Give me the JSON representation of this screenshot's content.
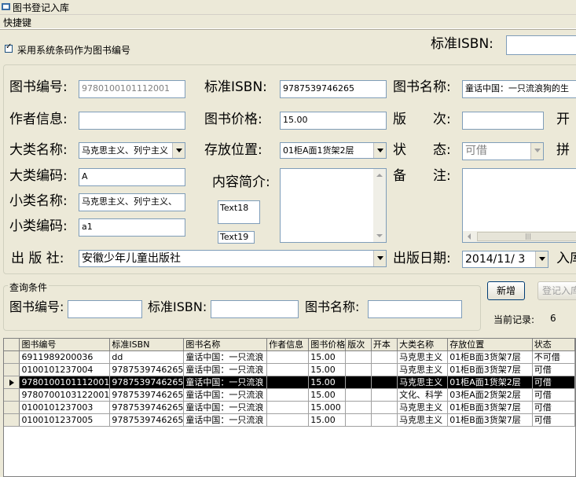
{
  "window": {
    "title": "图书登记入库"
  },
  "menu": {
    "shortcuts": "快捷键"
  },
  "top": {
    "use_barcode_label": "采用系统条码作为图书编号",
    "use_barcode_checked": true,
    "isbn_label": "标准ISBN:",
    "isbn_value": ""
  },
  "form": {
    "book_no_label": "图书编号:",
    "book_no_value": "9780100101112001",
    "isbn_label": "标准ISBN:",
    "isbn_value": "9787539746265",
    "title_label": "图书名称:",
    "title_value": "童话中国：一只流浪狗的生",
    "author_label": "作者信息:",
    "author_value": "",
    "price_label": "图书价格:",
    "price_value": "15.00",
    "edition_label": "版　　次:",
    "edition_value": "",
    "kai_label": "开",
    "category_label": "大类名称:",
    "category_value": "马克思主义、列宁主义",
    "location_label": "存放位置:",
    "location_value": "01柜A面1货架2层",
    "status_label": "状　　态:",
    "status_value": "可借",
    "pin_label": "拼",
    "category_code_label": "大类编码:",
    "category_code_value": "A",
    "summary_label": "内容简介:",
    "remark_label": "备　　注:",
    "subcategory_label": "小类名称:",
    "subcategory_value": "马克思主义、列宁主义、",
    "subcategory_code_label": "小类编码:",
    "subcategory_code_value": "a1",
    "text18": "Text18",
    "text19": "Text19",
    "publisher_label": "出 版 社:",
    "publisher_value": "安徽少年儿童出版社",
    "pubdate_label": "出版日期:",
    "pubdate_value": "2014/11/ 3",
    "ru_label": "入库"
  },
  "query": {
    "group_label": "查询条件",
    "book_no_label": "图书编号:",
    "isbn_label": "标准ISBN:",
    "title_label": "图书名称:"
  },
  "actions": {
    "new_label": "新增",
    "register_label": "登记入库",
    "current_record_label": "当前记录:",
    "current_record_value": "6"
  },
  "grid": {
    "columns": [
      "图书编号",
      "标准ISBN",
      "图书名称",
      "作者信息",
      "图书价格",
      "版次",
      "开本",
      "大类名称",
      "存放位置",
      "状态"
    ],
    "rows": [
      [
        "6911989200036",
        "dd",
        "童话中国：一只流浪",
        "",
        "15.00",
        "",
        "",
        "马克思主义",
        "01柜B面3货架7层",
        "不可借"
      ],
      [
        "0100101237004",
        "9787539746265",
        "童话中国：一只流浪",
        "",
        "15.00",
        "",
        "",
        "马克思主义",
        "01柜B面3货架7层",
        "可借"
      ],
      [
        "9780100101112001",
        "9787539746265",
        "童话中国：一只流浪",
        "",
        "15.00",
        "",
        "",
        "马克思主义",
        "01柜A面1货架2层",
        "可借"
      ],
      [
        "9780700103122001",
        "9787539746265",
        "童话中国：一只流浪",
        "",
        "15.00",
        "",
        "",
        "文化、科学",
        "03柜A面2货架2层",
        "可借"
      ],
      [
        "0100101237003",
        "9787539746265",
        "童话中国：一只流浪",
        "",
        "15.000",
        "",
        "",
        "马克思主义",
        "01柜B面3货架7层",
        "可借"
      ],
      [
        "0100101237005",
        "9787539746265",
        "童话中国：一只流浪",
        "",
        "15.00",
        "",
        "",
        "马克思主义",
        "01柜B面3货架7层",
        "可借"
      ]
    ],
    "selected_row": 2
  },
  "colors": {
    "input_border": "#7f9db9",
    "window_bg": "#ece9d8",
    "selected_row_bg": "#000000"
  }
}
